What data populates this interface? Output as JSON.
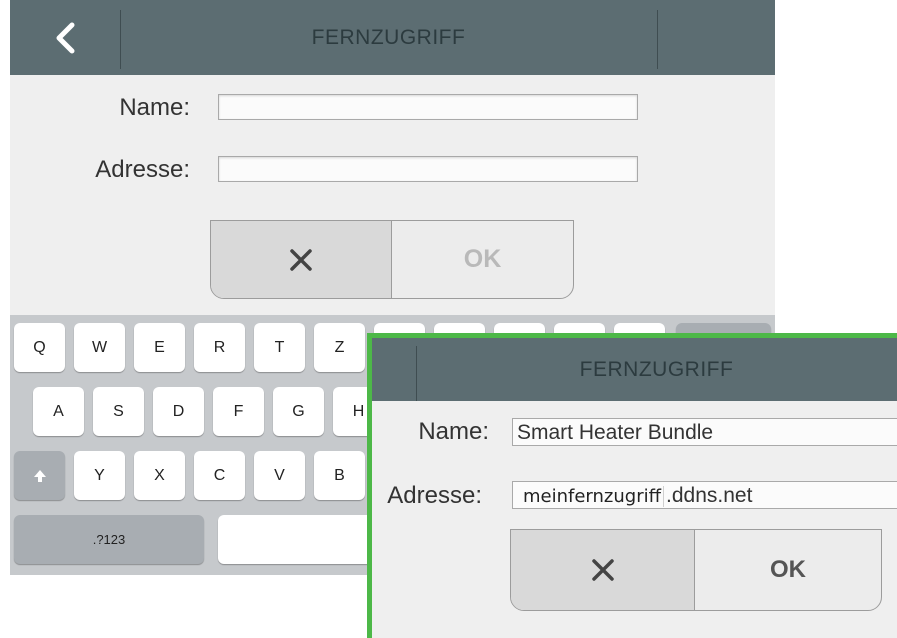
{
  "back_dialog": {
    "title": "FERNZUGRIFF",
    "name_label": "Name:",
    "address_label": "Adresse:",
    "name_value": "",
    "address_value": "",
    "ok_label": "OK"
  },
  "keyboard": {
    "row1": [
      "Q",
      "W",
      "E",
      "R",
      "T",
      "Z"
    ],
    "row2": [
      "A",
      "S",
      "D",
      "F",
      "G",
      "H"
    ],
    "row3": [
      "Y",
      "X",
      "C",
      "V",
      "B"
    ],
    "numbers_key": ".?123"
  },
  "front_dialog": {
    "title": "FERNZUGRIFF",
    "name_label": "Name:",
    "address_label": "Adresse:",
    "name_value": "Smart Heater Bundle",
    "address_prefix": "meinfernzugriff",
    "address_suffix": ".ddns.net",
    "ok_label": "OK"
  },
  "colors": {
    "header": "#5c6d72",
    "highlight_border": "#4db848",
    "panel_bg": "#efefef",
    "keyboard_bg": "#c6c9cc"
  },
  "icons": [
    "back-chevron-icon",
    "close-x-icon",
    "shift-arrow-icon"
  ]
}
